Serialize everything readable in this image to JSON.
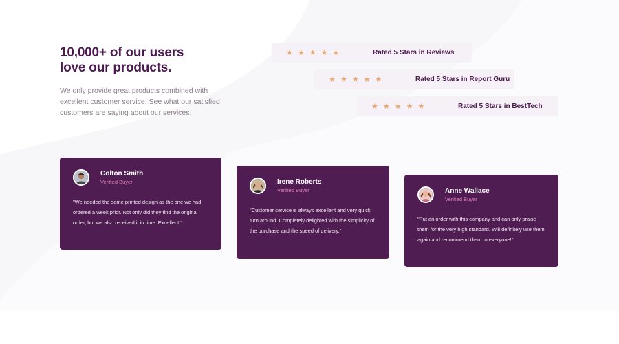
{
  "intro": {
    "headline_line1": "10,000+ of our users",
    "headline_line2": "love our products.",
    "description": "We only provide great products combined with excellent customer service. See what our satisfied customers are saying about our services."
  },
  "ratings": [
    {
      "stars": 5,
      "star_glyph": "★",
      "label": "Rated 5 Stars in Reviews"
    },
    {
      "stars": 5,
      "star_glyph": "★",
      "label": "Rated 5 Stars in Report Guru"
    },
    {
      "stars": 5,
      "star_glyph": "★",
      "label": "Rated 5 Stars in BestTech"
    }
  ],
  "testimonials": [
    {
      "name": "Colton Smith",
      "role": "Verified Buyer",
      "quote": "\"We needed the same printed design as the one we had ordered a week prior. Not only did they find the original order, but we also received it in time. Excellent!\""
    },
    {
      "name": "Irene Roberts",
      "role": "Verified Buyer",
      "quote": "\"Customer service is always excellent and very quick turn around. Completely delighted with the simplicity of the purchase and the speed of delivery.\""
    },
    {
      "name": "Anne Wallace",
      "role": "Verified Buyer",
      "quote": "\"Put an order with this company and can only praise them for the very high standard. Will definitely use them again and recommend them to everyone!\""
    }
  ],
  "colors": {
    "primary_purple": "#4b1a4e",
    "card_purple": "#4f1d51",
    "star_orange": "#e9a56f",
    "role_pink": "#e37fbb",
    "rating_bg": "#f6f1f6",
    "body_text": "#8c7f8e"
  }
}
